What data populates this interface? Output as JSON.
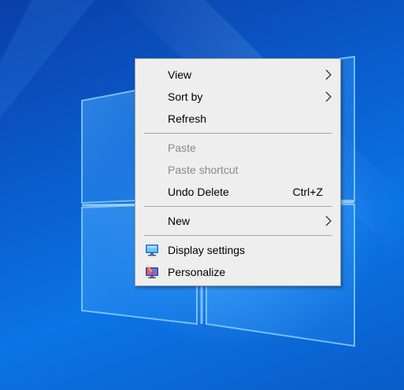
{
  "context_menu": {
    "items": [
      {
        "label": "View",
        "submenu": true,
        "enabled": true
      },
      {
        "label": "Sort by",
        "submenu": true,
        "enabled": true
      },
      {
        "label": "Refresh",
        "enabled": true
      },
      {
        "label": "Paste",
        "enabled": false
      },
      {
        "label": "Paste shortcut",
        "enabled": false
      },
      {
        "label": "Undo Delete",
        "shortcut": "Ctrl+Z",
        "enabled": true
      },
      {
        "label": "New",
        "submenu": true,
        "enabled": true
      },
      {
        "label": "Display settings",
        "icon": "display-settings-icon",
        "enabled": true
      },
      {
        "label": "Personalize",
        "icon": "personalize-icon",
        "enabled": true
      }
    ]
  },
  "colors": {
    "menu_background": "#eeeeee",
    "menu_border": "#a0a0a0",
    "disabled_text": "#8a8a8a",
    "desktop_blue": "#0a5fd0"
  }
}
